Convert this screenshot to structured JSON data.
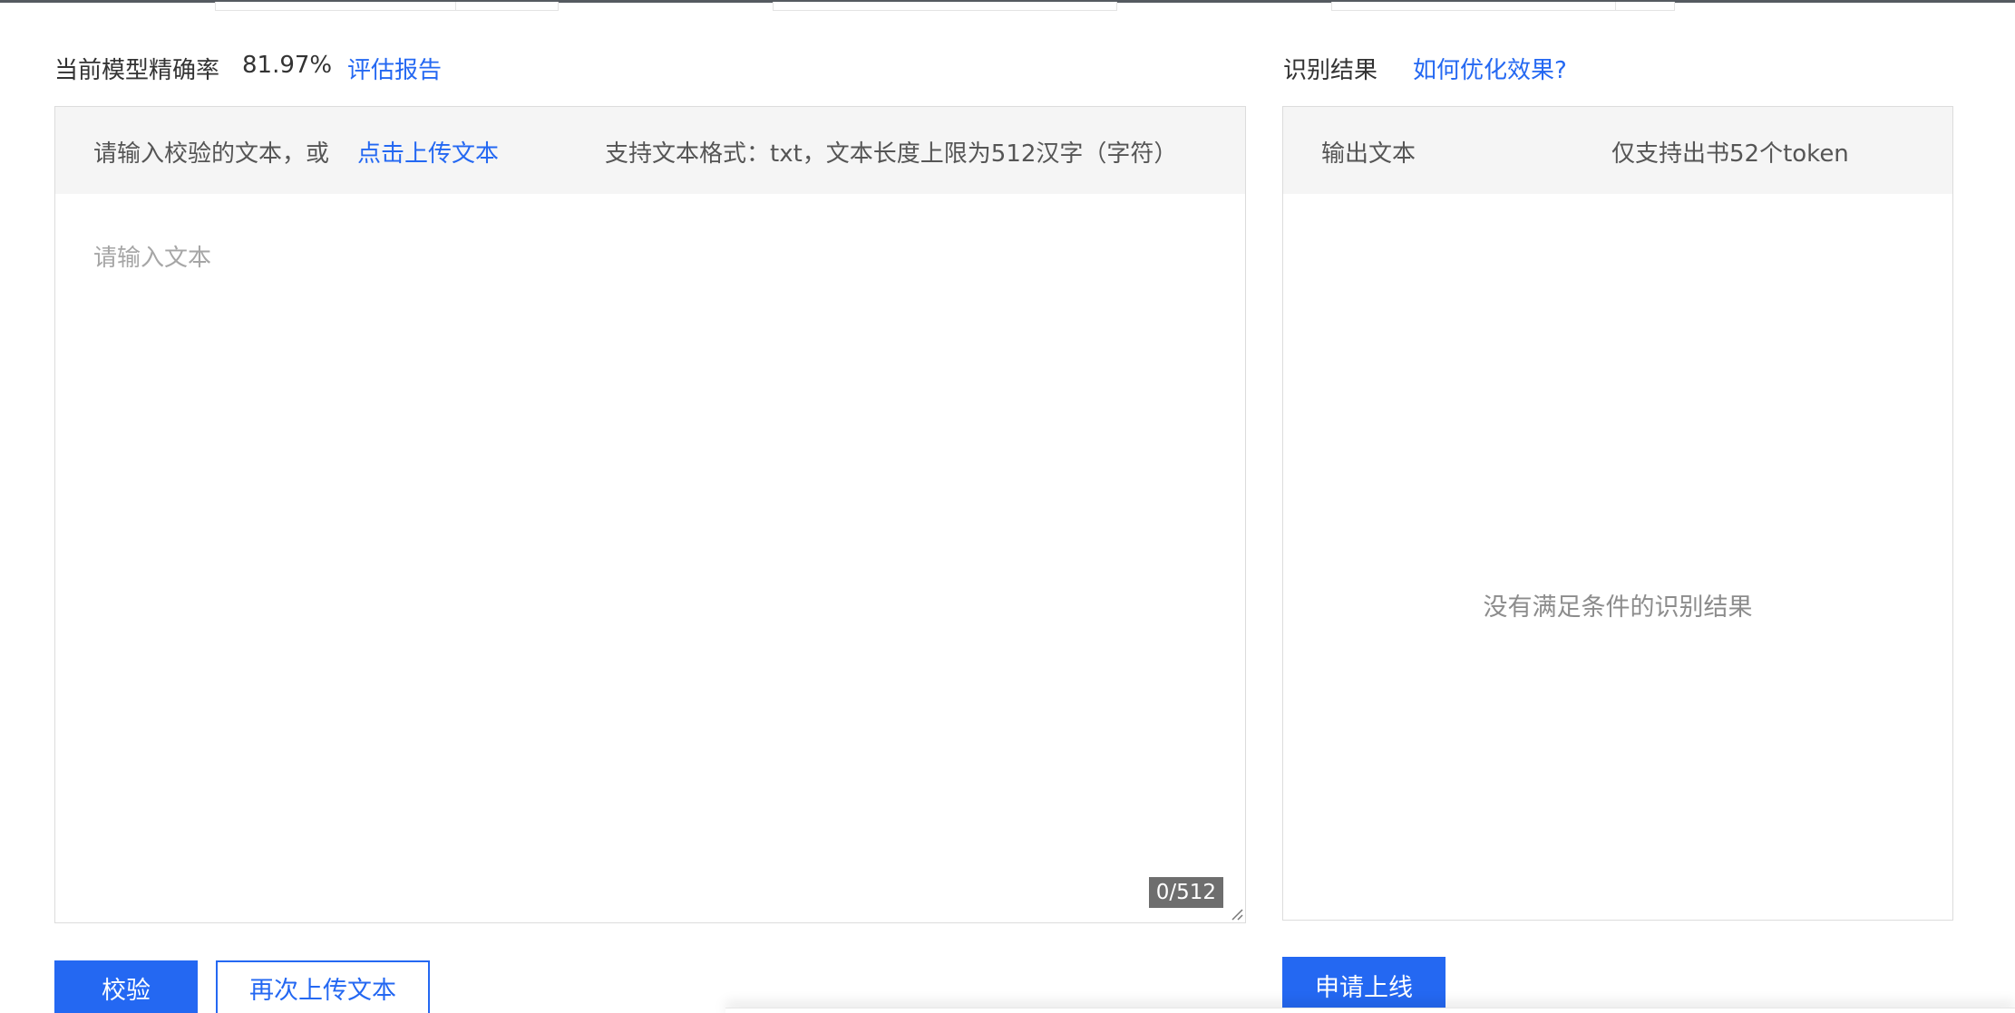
{
  "accuracy": {
    "label": "当前模型精确率",
    "value": "81.97%",
    "report_link": "评估报告"
  },
  "input_panel": {
    "prompt": "请输入校验的文本，或",
    "upload_link": "点击上传文本",
    "format_hint": "支持文本格式：txt，文本长度上限为512汉字（字符）",
    "placeholder": "请输入文本",
    "counter": "0/512"
  },
  "result": {
    "title": "识别结果",
    "optimize_link": "如何优化效果?",
    "output_label": "输出文本",
    "token_hint": "仅支持出书52个token",
    "empty_text": "没有满足条件的识别结果"
  },
  "actions": {
    "verify": "校验",
    "reupload": "再次上传文本",
    "apply_online": "申请上线"
  },
  "colors": {
    "accent": "#2468f2",
    "panel_header": "#f5f5f5",
    "border": "#dcdcdc"
  }
}
